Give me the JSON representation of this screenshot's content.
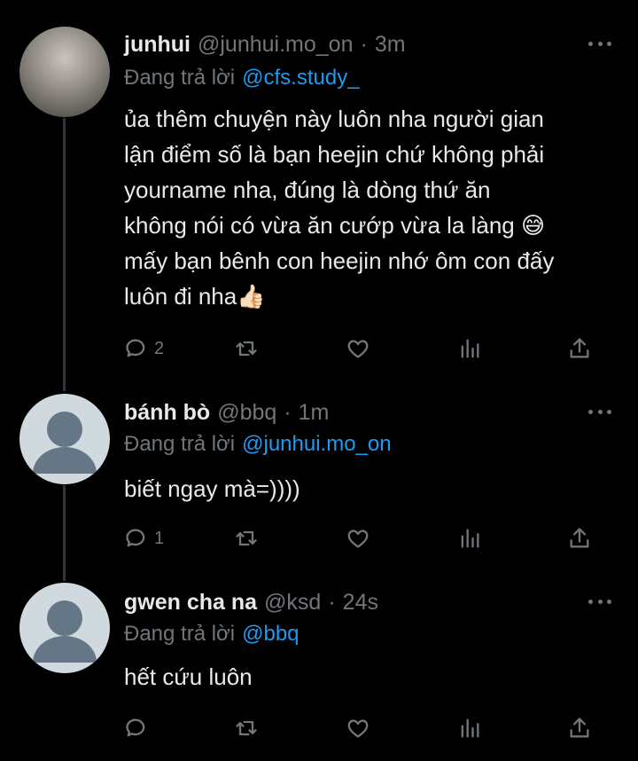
{
  "tweets": [
    {
      "name": "junhui",
      "handle": "@junhui.mo_on",
      "time": "3m",
      "reply_prefix": "Đang trả lời",
      "reply_mention": "@cfs.study_",
      "text": "ủa thêm chuyện này luôn nha người gian\nlận điểm số là bạn heejin chứ không phải\nyourname nha, đúng là dòng thứ ăn\nkhông nói có vừa ăn cướp vừa la làng 😅\nmấy bạn bênh con heejin nhớ ôm con đấy\nluôn đi nha👍🏻",
      "reply_count": "2"
    },
    {
      "name": "bánh bò",
      "handle": "@bbq",
      "time": "1m",
      "reply_prefix": "Đang trả lời",
      "reply_mention": "@junhui.mo_on",
      "text": "biết ngay mà=))))",
      "reply_count": "1"
    },
    {
      "name": "gwen cha na",
      "handle": "@ksd",
      "time": "24s",
      "reply_prefix": "Đang trả lời",
      "reply_mention": "@bbq",
      "text": "hết cứu luôn",
      "reply_count": ""
    }
  ],
  "icons": [
    "reply-icon",
    "retweet-icon",
    "like-icon",
    "analytics-icon",
    "share-icon",
    "more-icon"
  ],
  "colors": {
    "background": "#000000",
    "text": "#e7e9ea",
    "secondary": "#71767b",
    "mention": "#1d9bf0",
    "thread_line": "#333639"
  }
}
